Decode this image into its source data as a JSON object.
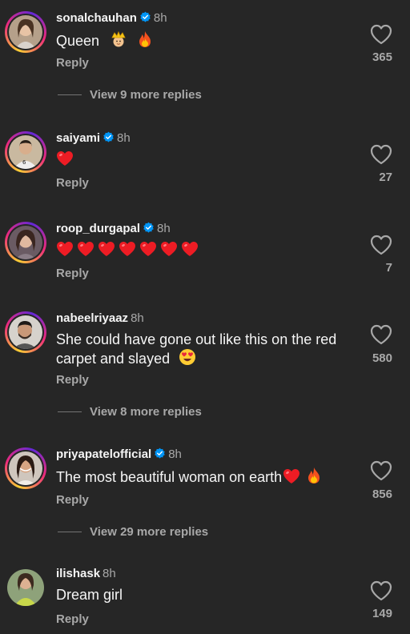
{
  "comments": [
    {
      "username": "sonalchauhan",
      "verified": true,
      "time": "8h",
      "text": "Queen",
      "emojis": [
        "crown-emoji",
        "fire-emoji"
      ],
      "reply_label": "Reply",
      "likes": "365",
      "view_more": "View 9 more replies"
    },
    {
      "username": "saiyami",
      "verified": true,
      "time": "8h",
      "text": "",
      "emojis": [
        "red-heart-emoji"
      ],
      "reply_label": "Reply",
      "likes": "27"
    },
    {
      "username": "roop_durgapal",
      "verified": true,
      "time": "8h",
      "text": "",
      "emojis": [
        "red-heart-emoji",
        "red-heart-emoji",
        "red-heart-emoji",
        "red-heart-emoji",
        "red-heart-emoji",
        "red-heart-emoji",
        "red-heart-emoji"
      ],
      "reply_label": "Reply",
      "likes": "7"
    },
    {
      "username": "nabeelriyaaz",
      "verified": false,
      "time": "8h",
      "text": "She could have gone out like this on the red carpet and slayed",
      "emojis": [
        "heart-eyes-emoji"
      ],
      "reply_label": "Reply",
      "likes": "580",
      "view_more": "View 8 more replies"
    },
    {
      "username": "priyapatelofficial",
      "verified": true,
      "time": "8h",
      "text": "The most beautiful woman on earth",
      "emojis": [
        "red-heart-emoji",
        "fire-emoji"
      ],
      "reply_label": "Reply",
      "likes": "856",
      "view_more": "View 29 more replies"
    },
    {
      "username": "ilishask",
      "verified": false,
      "time": "8h",
      "text": "Dream girl",
      "emojis": [],
      "reply_label": "Reply",
      "likes": "149"
    }
  ],
  "colors": {
    "background": "#262626",
    "primary_text": "#f5f5f5",
    "secondary_text": "#a8a8a8",
    "verified_blue": "#0095f6",
    "heart_red": "#ed1c24"
  }
}
